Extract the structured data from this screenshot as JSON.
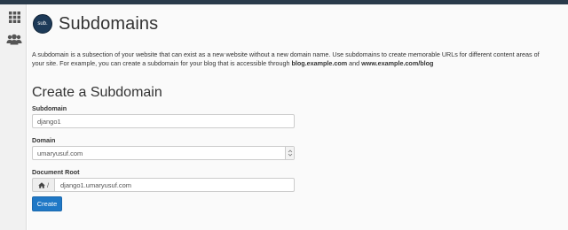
{
  "app": {
    "logo_text": "sub.",
    "title": "Subdomains"
  },
  "sidebar": {
    "items": [
      {
        "icon": "grid-icon"
      },
      {
        "icon": "users-icon"
      }
    ]
  },
  "description": {
    "line1": "A subdomain is a subsection of your website that can exist as a new website without a new domain name. Use subdomains to create memorable URLs for different content areas of",
    "line2_prefix": "your site. For example, you can create a subdomain for your blog that is accessible through ",
    "example1": "blog.example.com",
    "and": " and ",
    "example2": "www.example.com/blog"
  },
  "form": {
    "section_title": "Create a Subdomain",
    "subdomain_label": "Subdomain",
    "subdomain_value": "django1",
    "domain_label": "Domain",
    "domain_value": "umaryusuf.com",
    "docroot_label": "Document Root",
    "docroot_prefix": "/",
    "docroot_value": "django1.umaryusuf.com",
    "create_label": "Create"
  },
  "colors": {
    "topbar": "#293a4a",
    "button": "#1f78c6",
    "logo": "#1d3a58"
  }
}
